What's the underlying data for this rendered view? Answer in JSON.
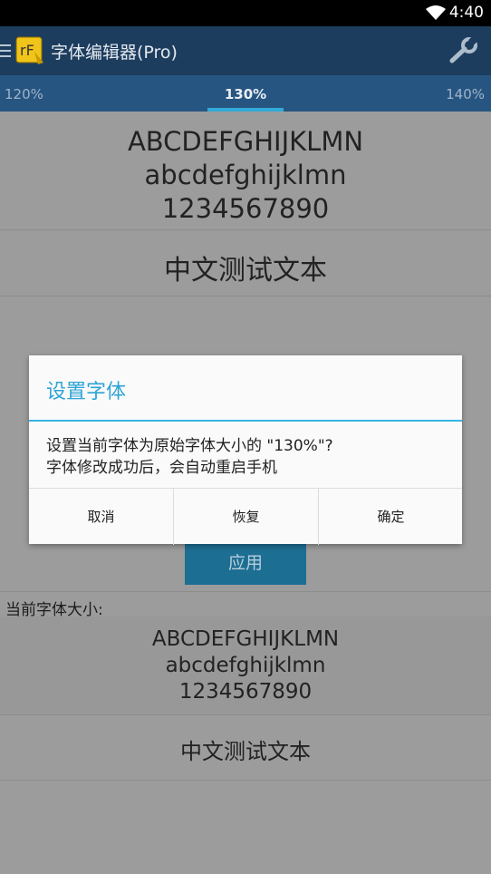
{
  "status_bar": {
    "time": "4:40"
  },
  "app": {
    "title": "字体编辑器(Pro)"
  },
  "tabs": {
    "left": "120%",
    "center": "130%",
    "right": "140%"
  },
  "preview": {
    "line1": "ABCDEFGHIJKLMN",
    "line2": "abcdefghijklmn",
    "line3": "1234567890",
    "chinese": "中文测试文本"
  },
  "apply_button": "应用",
  "current_font": {
    "label": "当前字体大小:",
    "line1": "ABCDEFGHIJKLMN",
    "line2": "abcdefghijklmn",
    "line3": "1234567890",
    "chinese": "中文测试文本"
  },
  "dialog": {
    "title": "设置字体",
    "message_line1": "设置当前字体为原始字体大小的 \"130%\"?",
    "message_line2": "字体修改成功后，会自动重启手机",
    "buttons": {
      "cancel": "取消",
      "restore": "恢复",
      "confirm": "确定"
    }
  },
  "colors": {
    "accent": "#33b5e5",
    "actionbar": "#1d3d5e",
    "tabstrip": "#275581"
  }
}
